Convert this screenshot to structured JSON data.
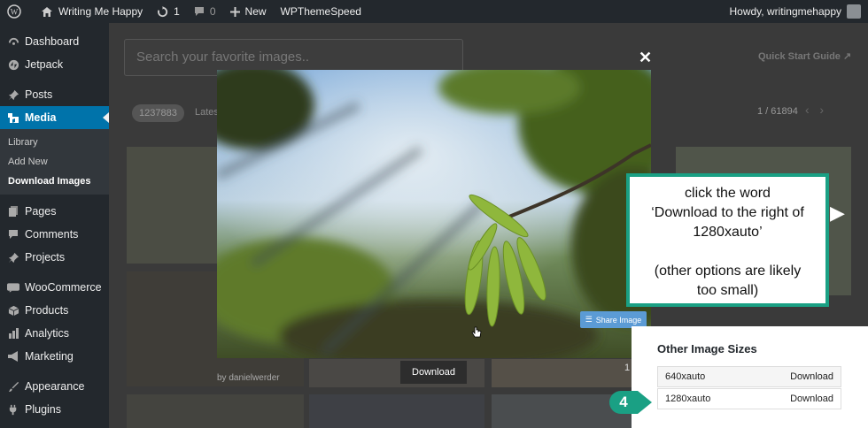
{
  "adminbar": {
    "site_name": "Writing Me Happy",
    "updates_count": "1",
    "comments_count": "0",
    "new_label": "New",
    "plugin_label": "WPThemeSpeed",
    "howdy": "Howdy, writingmehappy"
  },
  "sidebar": {
    "items": [
      {
        "label": "Dashboard",
        "icon": "dashboard-icon"
      },
      {
        "label": "Jetpack",
        "icon": "jetpack-icon"
      },
      {
        "label": "Posts",
        "icon": "pin-icon"
      },
      {
        "label": "Media",
        "icon": "media-icon"
      },
      {
        "label": "Pages",
        "icon": "pages-icon"
      },
      {
        "label": "Comments",
        "icon": "comment-icon"
      },
      {
        "label": "Projects",
        "icon": "pin-icon"
      },
      {
        "label": "WooCommerce",
        "icon": "woo-icon"
      },
      {
        "label": "Products",
        "icon": "box-icon"
      },
      {
        "label": "Analytics",
        "icon": "bar-chart-icon"
      },
      {
        "label": "Marketing",
        "icon": "megaphone-icon"
      },
      {
        "label": "Appearance",
        "icon": "brush-icon"
      },
      {
        "label": "Plugins",
        "icon": "plug-icon"
      }
    ],
    "submenu": [
      "Library",
      "Add New",
      "Download Images"
    ]
  },
  "main": {
    "search_placeholder": "Search your favorite images..",
    "quick_start": "Quick Start Guide",
    "result_count": "1237883",
    "sort_label": "Lates",
    "pager": "1 / 61894",
    "byline": "by danielwerder",
    "partial_number": "1"
  },
  "modal": {
    "share_label": "Share Image",
    "download_label": "Download"
  },
  "callout": {
    "line1": "click the word",
    "line2": "‘Download to the right of",
    "line3": "1280xauto’",
    "line4": "(other options are likely",
    "line5": "too small)"
  },
  "sizes": {
    "title": "Other Image Sizes",
    "rows": [
      {
        "size": "640xauto",
        "action": "Download"
      },
      {
        "size": "1280xauto",
        "action": "Download"
      }
    ]
  },
  "step_number": "4",
  "colors": {
    "admin_dark": "#23282d",
    "accent_blue": "#0073aa",
    "callout_green": "#1aa084"
  }
}
